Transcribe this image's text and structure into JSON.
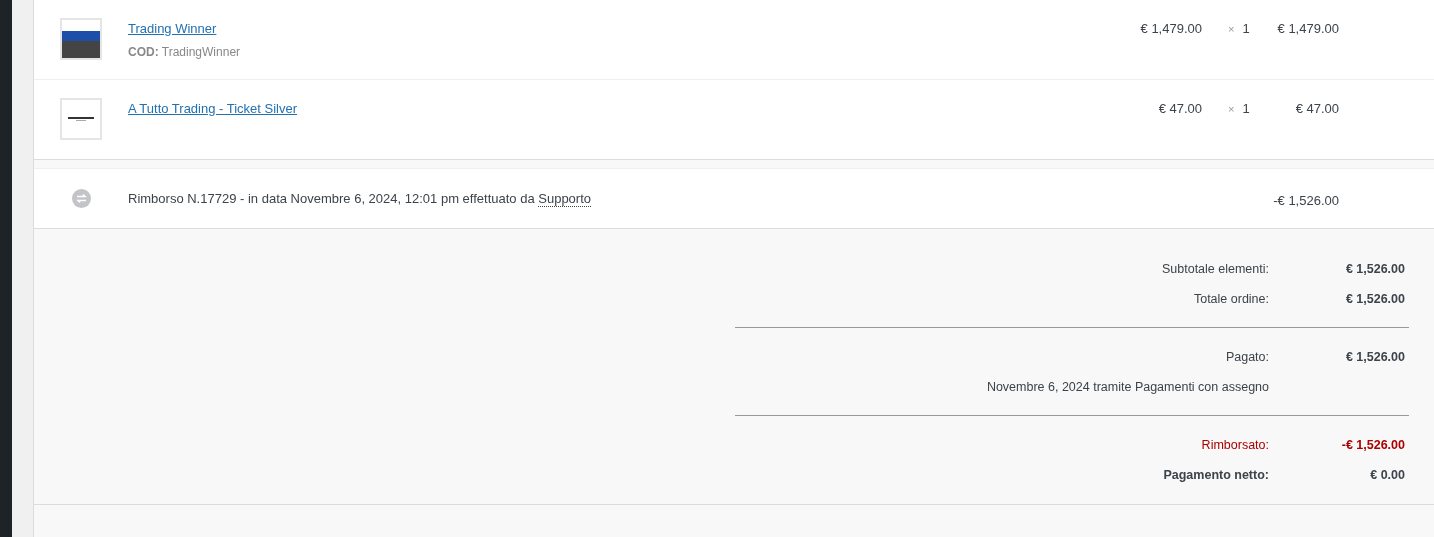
{
  "items": [
    {
      "name": "Trading Winner",
      "sku_label": "COD:",
      "sku": "TradingWinner",
      "cost": "€ 1,479.00",
      "qty_sign": "×",
      "qty": "1",
      "total": "€ 1,479.00"
    },
    {
      "name": "A Tutto Trading - Ticket Silver",
      "cost": "€ 47.00",
      "qty_sign": "×",
      "qty": "1",
      "total": "€ 47.00"
    }
  ],
  "refund": {
    "text": "Rimborso N.17729 - in data Novembre 6, 2024, 12:01 pm effettuato da",
    "by": "Supporto",
    "amount": "-€ 1,526.00"
  },
  "totals": [
    {
      "kind": "row",
      "label": "Subtotale elementi:",
      "value": "€ 1,526.00"
    },
    {
      "kind": "row",
      "label": "Totale ordine:",
      "value": "€ 1,526.00"
    },
    {
      "kind": "divider"
    },
    {
      "kind": "row",
      "label": "Pagato:",
      "value": "€ 1,526.00"
    },
    {
      "kind": "note",
      "text": "Novembre 6, 2024 tramite Pagamenti con assegno"
    },
    {
      "kind": "divider"
    },
    {
      "kind": "refund",
      "label": "Rimborsato:",
      "value": "-€ 1,526.00"
    },
    {
      "kind": "net",
      "label": "Pagamento netto:",
      "value": "€ 0.00"
    }
  ]
}
